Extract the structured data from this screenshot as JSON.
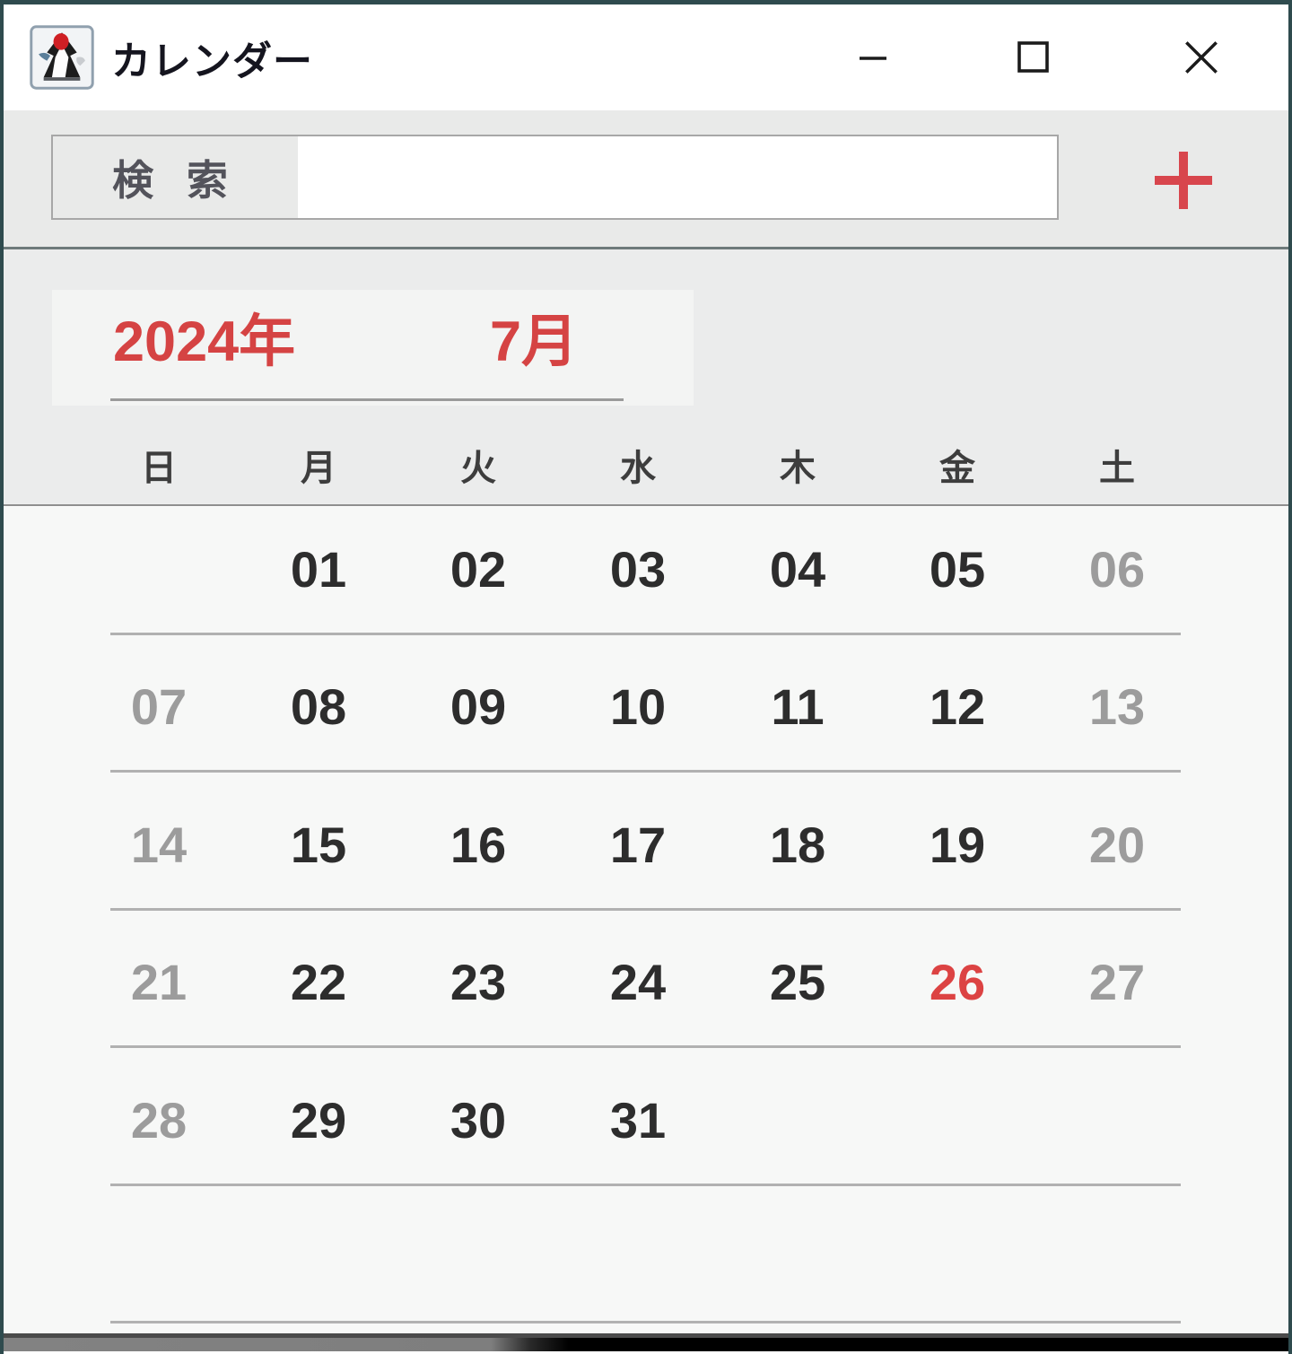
{
  "window": {
    "title": "カレンダー"
  },
  "toolbar": {
    "search_label": "検 索",
    "search_value": "",
    "add_label": "+"
  },
  "calendar": {
    "year_label": "2024年",
    "month_label": "7月",
    "weekdays": [
      "日",
      "月",
      "火",
      "水",
      "木",
      "金",
      "土"
    ],
    "today": "26",
    "weeks": [
      [
        {
          "text": "",
          "style": "empty"
        },
        {
          "text": "01",
          "style": "normal"
        },
        {
          "text": "02",
          "style": "normal"
        },
        {
          "text": "03",
          "style": "normal"
        },
        {
          "text": "04",
          "style": "normal"
        },
        {
          "text": "05",
          "style": "normal"
        },
        {
          "text": "06",
          "style": "dim"
        }
      ],
      [
        {
          "text": "07",
          "style": "dim"
        },
        {
          "text": "08",
          "style": "normal"
        },
        {
          "text": "09",
          "style": "normal"
        },
        {
          "text": "10",
          "style": "normal"
        },
        {
          "text": "11",
          "style": "normal"
        },
        {
          "text": "12",
          "style": "normal"
        },
        {
          "text": "13",
          "style": "dim"
        }
      ],
      [
        {
          "text": "14",
          "style": "dim"
        },
        {
          "text": "15",
          "style": "normal"
        },
        {
          "text": "16",
          "style": "normal"
        },
        {
          "text": "17",
          "style": "normal"
        },
        {
          "text": "18",
          "style": "normal"
        },
        {
          "text": "19",
          "style": "normal"
        },
        {
          "text": "20",
          "style": "dim"
        }
      ],
      [
        {
          "text": "21",
          "style": "dim"
        },
        {
          "text": "22",
          "style": "normal"
        },
        {
          "text": "23",
          "style": "normal"
        },
        {
          "text": "24",
          "style": "normal"
        },
        {
          "text": "25",
          "style": "normal"
        },
        {
          "text": "26",
          "style": "today"
        },
        {
          "text": "27",
          "style": "dim"
        }
      ],
      [
        {
          "text": "28",
          "style": "dim"
        },
        {
          "text": "29",
          "style": "normal"
        },
        {
          "text": "30",
          "style": "normal"
        },
        {
          "text": "31",
          "style": "normal"
        },
        {
          "text": "",
          "style": "empty"
        },
        {
          "text": "",
          "style": "empty"
        },
        {
          "text": "",
          "style": "empty"
        }
      ],
      [
        {
          "text": "",
          "style": "empty"
        },
        {
          "text": "",
          "style": "empty"
        },
        {
          "text": "",
          "style": "empty"
        },
        {
          "text": "",
          "style": "empty"
        },
        {
          "text": "",
          "style": "empty"
        },
        {
          "text": "",
          "style": "empty"
        },
        {
          "text": "",
          "style": "empty"
        }
      ]
    ]
  },
  "colors": {
    "accent_red": "#d54343",
    "today_red": "#dc4343",
    "dim_gray": "#9c9c9c",
    "date_black": "#2d2d2d"
  }
}
